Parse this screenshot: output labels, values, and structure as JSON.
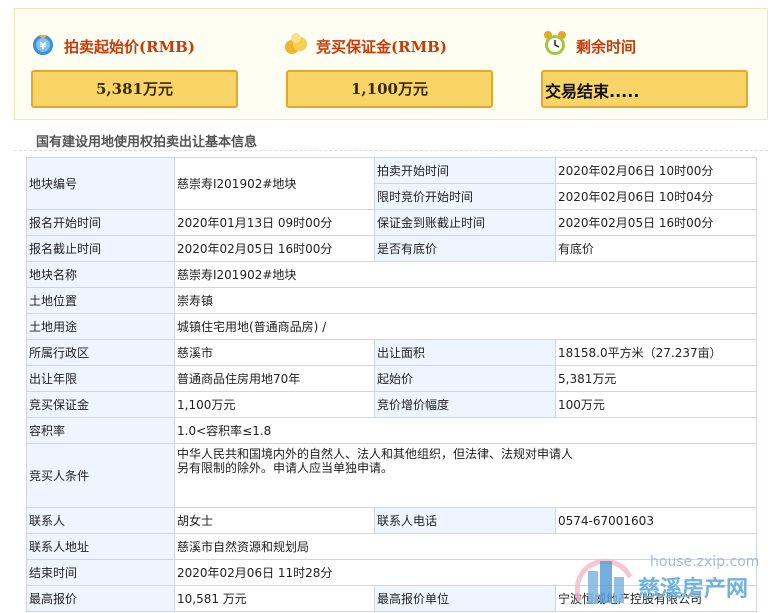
{
  "summary": {
    "start_price_label": "拍卖起始价",
    "start_price_unit": "(RMB)",
    "start_price_value": "5,381万元",
    "deposit_label": "竞买保证金",
    "deposit_unit": "(RMB)",
    "deposit_value": "1,100万元",
    "time_left_label": "剩余时间",
    "time_left_value": "交易结束....."
  },
  "section_title": "国有建设用地使用权拍卖出让基本信息",
  "table": {
    "plot_no_label": "地块编号",
    "plot_no_value": "慈崇寿I201902#地块",
    "auction_start_label": "拍卖开始时间",
    "auction_start_value": "2020年02月06日 10时00分",
    "timed_bid_label": "限时竞价开始时间",
    "timed_bid_value": "2020年02月06日 10时04分",
    "reg_start_label": "报名开始时间",
    "reg_start_value": "2020年01月13日 09时00分",
    "deposit_deadline_label": "保证金到账截止时间",
    "deposit_deadline_value": "2020年02月05日 16时00分",
    "reg_end_label": "报名截止时间",
    "reg_end_value": "2020年02月05日 16时00分",
    "reserve_label": "是否有底价",
    "reserve_value": "有底价",
    "plot_name_label": "地块名称",
    "plot_name_value": "慈崇寿I201902#地块",
    "location_label": "土地位置",
    "location_value": "崇寿镇",
    "use_label": "土地用途",
    "use_value": "城镇住宅用地(普通商品房) /",
    "district_label": "所属行政区",
    "district_value": "慈溪市",
    "area_label": "出让面积",
    "area_value": "18158.0平方米（27.237亩）",
    "term_label": "出让年限",
    "term_value": "普通商品住房用地70年",
    "start_price_label": "起始价",
    "start_price_value": "5,381万元",
    "deposit_label": "竞买保证金",
    "deposit_value": "1,100万元",
    "increment_label": "竞价增价幅度",
    "increment_value": "100万元",
    "far_label": "容积率",
    "far_value": "1.0<容积率≤1.8",
    "conditions_label": "竞买人条件",
    "conditions_value": "中华人民共和国境内外的自然人、法人和其他组织，但法律、法规对申请人另有限制的除外。申请人应当单独申请。",
    "contact_label": "联系人",
    "contact_value": "胡女士",
    "phone_label": "联系人电话",
    "phone_value": "0574-67001603",
    "address_label": "联系人地址",
    "address_value": "慈溪市自然资源和规划局",
    "end_time_label": "结束时间",
    "end_time_value": "2020年02月06日 11时28分",
    "top_bid_label": "最高报价",
    "top_bid_value": "10,581 万元",
    "top_bidder_label": "最高报价单位",
    "top_bidder_value": "宁波恒威地产控股有限公司"
  },
  "watermark": {
    "url": "house.zxip.com",
    "brand": "慈溪房产网"
  },
  "colors": {
    "accent": "#c83a08",
    "value_box_fill": "#f9d567",
    "value_box_border": "#e8a52a",
    "label_cell": "#eef5ff",
    "border": "#cfd5e3"
  }
}
